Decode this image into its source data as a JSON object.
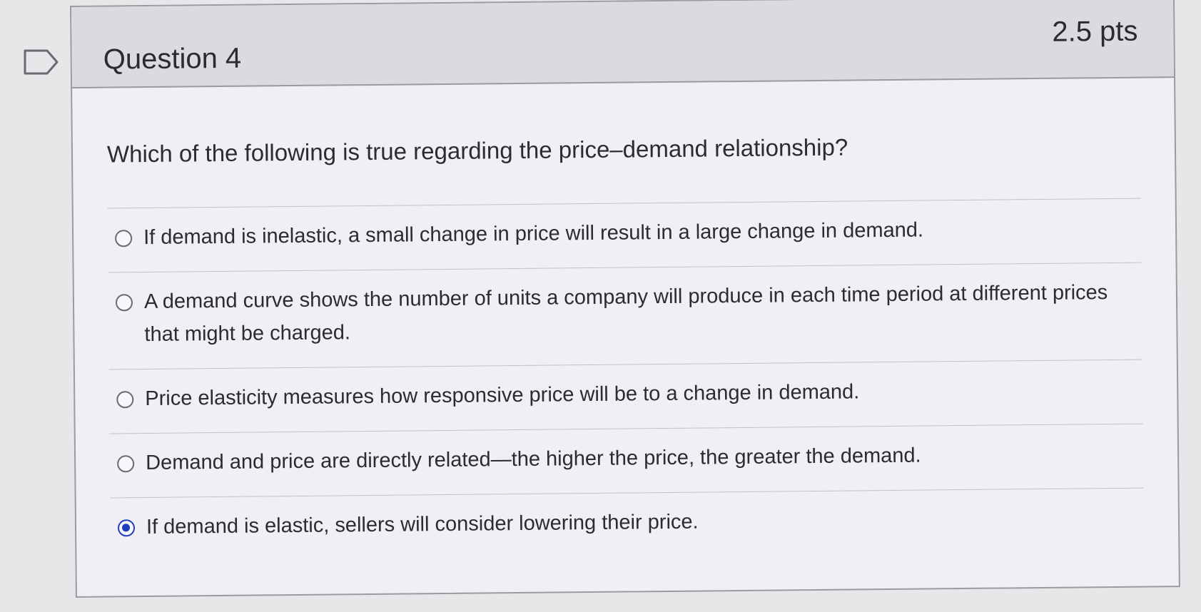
{
  "question": {
    "title": "Question 4",
    "points": "2.5 pts",
    "prompt": "Which of the following is true regarding the price–demand relationship?",
    "flag_icon": "flag-outline-icon"
  },
  "answers": [
    {
      "label": "If demand is inelastic, a small change in price will result in a large change in demand.",
      "selected": false
    },
    {
      "label": "A demand curve shows the number of units a company will produce in each time period at different prices that might be charged.",
      "selected": false
    },
    {
      "label": "Price elasticity measures how responsive price will be to a change in demand.",
      "selected": false
    },
    {
      "label": "Demand and price are directly related—the higher the price, the greater the demand.",
      "selected": false
    },
    {
      "label": "If demand is elastic, sellers will consider lowering their price.",
      "selected": true
    }
  ],
  "colors": {
    "selected_radio": "#1f3fbf",
    "header_bg": "#dcdadf",
    "body_bg": "#f1eff3"
  }
}
